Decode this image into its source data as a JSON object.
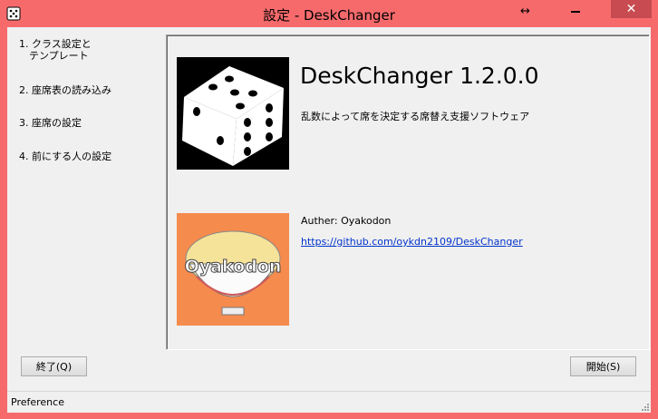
{
  "window": {
    "title": "設定 - DeskChanger"
  },
  "nav": {
    "items": [
      {
        "label": "1. クラス設定と\n　テンプレート"
      },
      {
        "label": "2. 座席表の読み込み"
      },
      {
        "label": "3. 座席の設定"
      },
      {
        "label": "4. 前にする人の設定"
      }
    ]
  },
  "about": {
    "app_name": "DeskChanger 1.2.0.0",
    "description": "乱数によって席を決定する席替え支援ソフトウェア",
    "author": "Auther: Oyakodon",
    "repo_url": "https://github.com/oykdn2109/DeskChanger",
    "author_logo_text": "Oyakodon"
  },
  "buttons": {
    "exit_label": "終了(Q)",
    "start_label": "開始(S)"
  },
  "status": {
    "text": "Preference"
  },
  "colors": {
    "titlebar": "#f76a6c",
    "close": "#c74b50",
    "link": "#0033cc",
    "author_bg": "#f58b4d"
  }
}
